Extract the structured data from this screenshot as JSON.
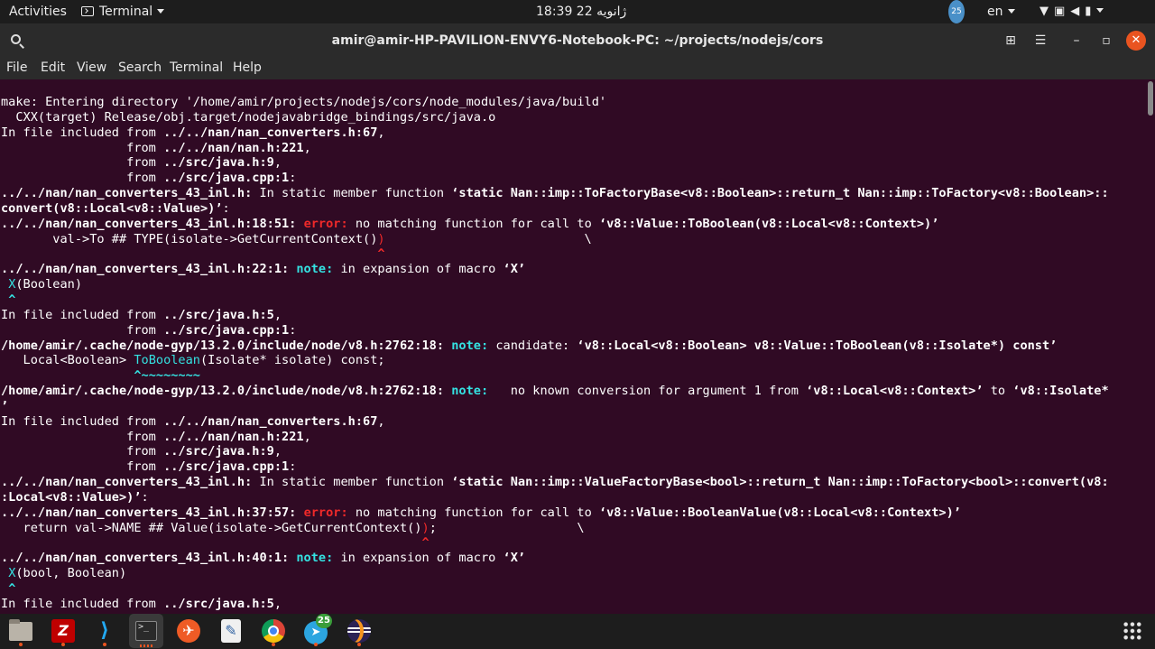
{
  "topbar": {
    "activities": "Activities",
    "app_menu": "Terminal",
    "clock": "18:39  22 ژانویه",
    "tray_badge": "25",
    "lang": "en"
  },
  "window": {
    "title": "amir@amir-HP-PAVILION-ENVY6-Notebook-PC: ~/projects/nodejs/cors",
    "buttons": {
      "new_tab": "new-tab-icon",
      "menu": "hamburger-icon",
      "minimize": "minimize-icon",
      "maximize": "maximize-icon",
      "close": "close-icon"
    }
  },
  "menubar": {
    "items": [
      "File",
      "Edit",
      "View",
      "Search",
      "Terminal",
      "Help"
    ]
  },
  "terminal": {
    "colors": {
      "background": "#300a24",
      "error": "#ef2929",
      "note": "#34e2e2"
    },
    "lines": [
      [
        {
          "t": "make: Entering directory '/home/amir/projects/nodejs/cors/node_modules/java/build'"
        }
      ],
      [
        {
          "t": "  CXX(target) Release/obj.target/nodejavabridge_bindings/src/java.o"
        }
      ],
      [
        {
          "t": "In file included from "
        },
        {
          "t": "../../nan/nan_converters.h:67",
          "c": "b"
        },
        {
          "t": ","
        }
      ],
      [
        {
          "t": "                 from "
        },
        {
          "t": "../../nan/nan.h:221",
          "c": "b"
        },
        {
          "t": ","
        }
      ],
      [
        {
          "t": "                 from "
        },
        {
          "t": "../src/java.h:9",
          "c": "b"
        },
        {
          "t": ","
        }
      ],
      [
        {
          "t": "                 from "
        },
        {
          "t": "../src/java.cpp:1",
          "c": "b"
        },
        {
          "t": ":"
        }
      ],
      [
        {
          "t": "../../nan/nan_converters_43_inl.h:",
          "c": "b"
        },
        {
          "t": " In static member function "
        },
        {
          "t": "‘static Nan::imp::ToFactoryBase<v8::Boolean>::return_t Nan::imp::ToFactory<v8::Boolean>::",
          "c": "b"
        }
      ],
      [
        {
          "t": "convert(v8::Local<v8::Value>)’",
          "c": "b"
        },
        {
          "t": ":"
        }
      ],
      [
        {
          "t": "../../nan/nan_converters_43_inl.h:18:51:",
          "c": "b"
        },
        {
          "t": " "
        },
        {
          "t": "error:",
          "c": "err"
        },
        {
          "t": " no matching function for call to "
        },
        {
          "t": "‘v8::Value::ToBoolean(v8::Local<v8::Context>)’",
          "c": "b"
        }
      ],
      [
        {
          "t": "       val->To ## TYPE(isolate->GetCurrentContext()"
        },
        {
          "t": ")",
          "c": "hl-err"
        },
        {
          "t": "                           \\"
        }
      ],
      [
        {
          "t": "                                                   "
        },
        {
          "t": "^",
          "c": "caret-err"
        }
      ],
      [
        {
          "t": "../../nan/nan_converters_43_inl.h:22:1:",
          "c": "b"
        },
        {
          "t": " "
        },
        {
          "t": "note:",
          "c": "note"
        },
        {
          "t": " in expansion of macro "
        },
        {
          "t": "‘X’",
          "c": "b"
        }
      ],
      [
        {
          "t": " "
        },
        {
          "t": "X",
          "c": "hl-cyan"
        },
        {
          "t": "(Boolean)"
        }
      ],
      [
        {
          "t": " "
        },
        {
          "t": "^",
          "c": "caret-cyan"
        }
      ],
      [
        {
          "t": "In file included from "
        },
        {
          "t": "../src/java.h:5",
          "c": "b"
        },
        {
          "t": ","
        }
      ],
      [
        {
          "t": "                 from "
        },
        {
          "t": "../src/java.cpp:1",
          "c": "b"
        },
        {
          "t": ":"
        }
      ],
      [
        {
          "t": "/home/amir/.cache/node-gyp/13.2.0/include/node/v8.h:2762:18:",
          "c": "b"
        },
        {
          "t": " "
        },
        {
          "t": "note:",
          "c": "note"
        },
        {
          "t": " candidate: "
        },
        {
          "t": "‘v8::Local<v8::Boolean> v8::Value::ToBoolean(v8::Isolate*) const’",
          "c": "b"
        }
      ],
      [
        {
          "t": "   Local<Boolean> "
        },
        {
          "t": "ToBoolean",
          "c": "hl-cyan"
        },
        {
          "t": "(Isolate* isolate) const;"
        }
      ],
      [
        {
          "t": "                  "
        },
        {
          "t": "^~~~~~~~~",
          "c": "caret-cyan"
        }
      ],
      [
        {
          "t": "/home/amir/.cache/node-gyp/13.2.0/include/node/v8.h:2762:18:",
          "c": "b"
        },
        {
          "t": " "
        },
        {
          "t": "note:",
          "c": "note"
        },
        {
          "t": "   no known conversion for argument 1 from "
        },
        {
          "t": "‘v8::Local<v8::Context>’",
          "c": "b"
        },
        {
          "t": " to "
        },
        {
          "t": "‘v8::Isolate*",
          "c": "b"
        }
      ],
      [
        {
          "t": "’",
          "c": "b"
        }
      ],
      [
        {
          "t": "In file included from "
        },
        {
          "t": "../../nan/nan_converters.h:67",
          "c": "b"
        },
        {
          "t": ","
        }
      ],
      [
        {
          "t": "                 from "
        },
        {
          "t": "../../nan/nan.h:221",
          "c": "b"
        },
        {
          "t": ","
        }
      ],
      [
        {
          "t": "                 from "
        },
        {
          "t": "../src/java.h:9",
          "c": "b"
        },
        {
          "t": ","
        }
      ],
      [
        {
          "t": "                 from "
        },
        {
          "t": "../src/java.cpp:1",
          "c": "b"
        },
        {
          "t": ":"
        }
      ],
      [
        {
          "t": "../../nan/nan_converters_43_inl.h:",
          "c": "b"
        },
        {
          "t": " In static member function "
        },
        {
          "t": "‘static Nan::imp::ValueFactoryBase<bool>::return_t Nan::imp::ToFactory<bool>::convert(v8:",
          "c": "b"
        }
      ],
      [
        {
          "t": ":Local<v8::Value>)’",
          "c": "b"
        },
        {
          "t": ":"
        }
      ],
      [
        {
          "t": "../../nan/nan_converters_43_inl.h:37:57:",
          "c": "b"
        },
        {
          "t": " "
        },
        {
          "t": "error:",
          "c": "err"
        },
        {
          "t": " no matching function for call to "
        },
        {
          "t": "‘v8::Value::BooleanValue(v8::Local<v8::Context>)’",
          "c": "b"
        }
      ],
      [
        {
          "t": "   return val->NAME ## Value(isolate->GetCurrentContext()"
        },
        {
          "t": ")",
          "c": "hl-err"
        },
        {
          "t": ";                   \\"
        }
      ],
      [
        {
          "t": "                                                         "
        },
        {
          "t": "^",
          "c": "caret-err"
        }
      ],
      [
        {
          "t": "../../nan/nan_converters_43_inl.h:40:1:",
          "c": "b"
        },
        {
          "t": " "
        },
        {
          "t": "note:",
          "c": "note"
        },
        {
          "t": " in expansion of macro "
        },
        {
          "t": "‘X’",
          "c": "b"
        }
      ],
      [
        {
          "t": " "
        },
        {
          "t": "X",
          "c": "hl-cyan"
        },
        {
          "t": "(bool, Boolean)"
        }
      ],
      [
        {
          "t": " "
        },
        {
          "t": "^",
          "c": "caret-cyan"
        }
      ],
      [
        {
          "t": "In file included from "
        },
        {
          "t": "../src/java.h:5",
          "c": "b"
        },
        {
          "t": ","
        }
      ]
    ]
  },
  "dock": {
    "apps": [
      {
        "name": "files",
        "icon": "folder-icon"
      },
      {
        "name": "filezilla",
        "icon": "filezilla-icon",
        "glyph": "Z"
      },
      {
        "name": "vscode",
        "icon": "vscode-icon",
        "glyph": "⟩"
      },
      {
        "name": "terminal",
        "icon": "terminal-icon",
        "glyph": ">_"
      },
      {
        "name": "postman",
        "icon": "postman-icon",
        "glyph": "✈"
      },
      {
        "name": "text-editor",
        "icon": "text-editor-icon",
        "glyph": "✎"
      },
      {
        "name": "chromium",
        "icon": "chromium-icon"
      },
      {
        "name": "telegram",
        "icon": "telegram-icon",
        "glyph": "➤",
        "badge": "25"
      },
      {
        "name": "eclipse",
        "icon": "eclipse-icon"
      }
    ],
    "show_apps": "app-grid-icon"
  }
}
